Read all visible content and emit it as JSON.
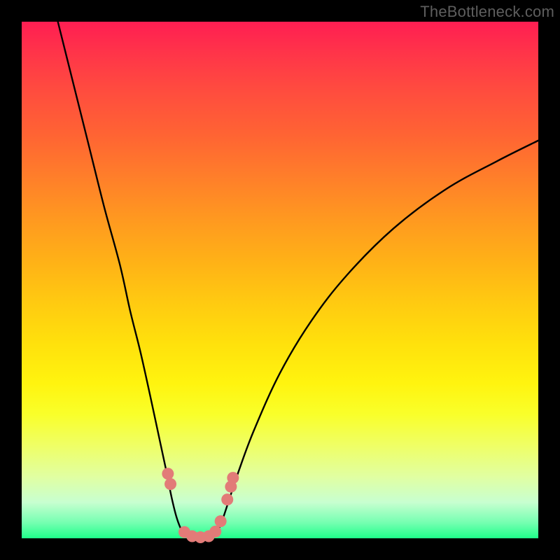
{
  "watermark": "TheBottleneck.com",
  "colors": {
    "background": "#000000",
    "gradient_top": "#ff1e52",
    "gradient_mid": "#ffe00c",
    "gradient_bottom": "#1fff8a",
    "curve": "#000000",
    "marker": "#e27b78"
  },
  "chart_data": {
    "type": "line",
    "title": "",
    "xlabel": "",
    "ylabel": "",
    "xlim": [
      0,
      100
    ],
    "ylim": [
      0,
      100
    ],
    "grid": false,
    "legend": false,
    "series": [
      {
        "name": "left-branch",
        "x": [
          7,
          10,
          13,
          16,
          19,
          21,
          23,
          25,
          26.5,
          28,
          29,
          30,
          31,
          32,
          33
        ],
        "y": [
          100,
          88,
          76,
          64,
          53,
          44,
          36,
          27,
          20,
          13,
          8,
          4,
          1.5,
          0.5,
          0
        ]
      },
      {
        "name": "floor",
        "x": [
          33,
          34,
          35,
          36,
          37
        ],
        "y": [
          0,
          0,
          0,
          0,
          0
        ]
      },
      {
        "name": "right-branch",
        "x": [
          37,
          38,
          39,
          40,
          42,
          45,
          50,
          56,
          63,
          72,
          82,
          92,
          100
        ],
        "y": [
          0,
          1.5,
          4,
          7,
          13,
          21,
          32,
          42,
          51,
          60,
          67.5,
          73,
          77
        ]
      }
    ],
    "markers": {
      "name": "highlight-points",
      "shape": "circle",
      "color": "#e27b78",
      "points": [
        {
          "x": 28.3,
          "y": 12.5
        },
        {
          "x": 28.8,
          "y": 10.5
        },
        {
          "x": 31.5,
          "y": 1.2
        },
        {
          "x": 33.0,
          "y": 0.4
        },
        {
          "x": 34.6,
          "y": 0.2
        },
        {
          "x": 36.2,
          "y": 0.4
        },
        {
          "x": 37.5,
          "y": 1.3
        },
        {
          "x": 38.5,
          "y": 3.3
        },
        {
          "x": 39.8,
          "y": 7.5
        },
        {
          "x": 40.5,
          "y": 10.0
        },
        {
          "x": 40.9,
          "y": 11.7
        }
      ]
    }
  }
}
